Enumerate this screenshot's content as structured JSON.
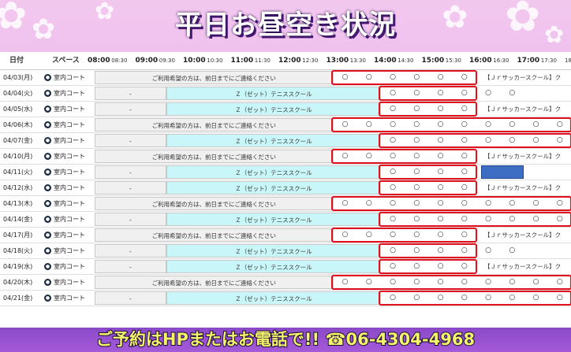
{
  "title": "平日お昼空き状況",
  "header": {
    "date_label": "日付",
    "space_label": "スペース",
    "times": [
      "08:00",
      "08:30",
      "09:00",
      "09:30",
      "10:00",
      "10:30",
      "11:00",
      "11:30",
      "12:00",
      "12:30",
      "13:00",
      "13:30",
      "14:00",
      "14:30",
      "15:00",
      "15:30",
      "16:00",
      "16:30",
      "17:00",
      "17:30",
      "18:"
    ]
  },
  "space_name": "室内コート",
  "labels": {
    "notice": "ご利用希望の方は、前日までにご連絡ください",
    "tennis": "Ｚ（ゼット）テニススクール",
    "soccer": "【Ｊｒサッカースクール】ク",
    "dash": "-",
    "available": "○"
  },
  "rows": [
    {
      "date": "04/03(月)",
      "type": "A",
      "slots": 6,
      "box": [
        13.0,
        16.0
      ],
      "box2": [
        16.0,
        18.5
      ]
    },
    {
      "date": "04/04(火)",
      "type": "B",
      "slots": 6,
      "box": [
        14.0,
        16.0
      ],
      "box2": [
        16.0,
        17.0
      ]
    },
    {
      "date": "04/05(水)",
      "type": "C",
      "slots": 4,
      "box": [
        14.0,
        16.0
      ],
      "box2": null
    },
    {
      "date": "04/06(木)",
      "type": "D",
      "slots": 10,
      "box": [
        13.0,
        18.5
      ],
      "box2": null
    },
    {
      "date": "04/07(金)",
      "type": "E",
      "slots": 8,
      "box": [
        14.0,
        18.5
      ],
      "box2": null
    },
    {
      "date": "04/10(月)",
      "type": "A",
      "slots": 6,
      "box": [
        13.0,
        16.0
      ],
      "box2": null
    },
    {
      "date": "04/11(火)",
      "type": "F",
      "slots": 4,
      "box": [
        14.0,
        16.0
      ],
      "box2": null
    },
    {
      "date": "04/12(水)",
      "type": "C",
      "slots": 4,
      "box": [
        14.0,
        16.0
      ],
      "box2": null
    },
    {
      "date": "04/13(木)",
      "type": "D",
      "slots": 10,
      "box": [
        13.0,
        18.5
      ],
      "box2": null
    },
    {
      "date": "04/14(金)",
      "type": "E",
      "slots": 8,
      "box": [
        14.0,
        18.5
      ],
      "box2": null
    },
    {
      "date": "04/17(月)",
      "type": "A",
      "slots": 6,
      "box": [
        13.0,
        16.0
      ],
      "box2": null
    },
    {
      "date": "04/18(火)",
      "type": "B",
      "slots": 6,
      "box": [
        14.0,
        16.0
      ],
      "box2": null
    },
    {
      "date": "04/19(水)",
      "type": "C",
      "slots": 4,
      "box": [
        14.0,
        16.0
      ],
      "box2": null
    },
    {
      "date": "04/20(木)",
      "type": "D",
      "slots": 10,
      "box": [
        13.0,
        18.5
      ],
      "box2": null
    },
    {
      "date": "04/21(金)",
      "type": "E",
      "slots": 8,
      "box": [
        14.0,
        18.5
      ],
      "box2": null
    }
  ],
  "banner": "ご予約はHPまたはお電話で!! ☎06-4304-4968",
  "colors": {
    "available_box": "#e0101c",
    "tennis_bg": "#c9f6f8",
    "notice_bg": "#f0f0f0",
    "booked": "#3e6ec4"
  }
}
